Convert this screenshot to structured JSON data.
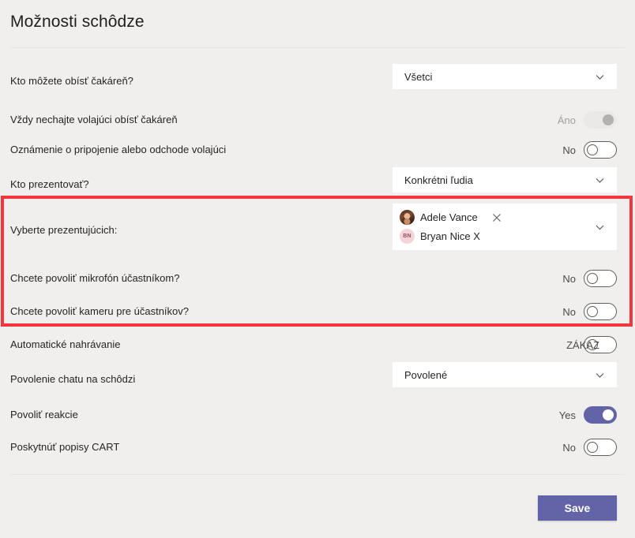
{
  "header": {
    "title": "Možnosti schôdze"
  },
  "rows": [
    {
      "label": "Kto môžete obísť čakáreň?",
      "control": "dropdown",
      "value": "Všetci"
    },
    {
      "label": "Vždy nechajte volajúci obísť čakáreň",
      "control": "toggle",
      "state_label": "Áno",
      "state": "disabled-on"
    },
    {
      "label": "Oznámenie o pripojenie alebo odchode volajúci",
      "control": "toggle",
      "state_label": "No",
      "state": "off"
    },
    {
      "label": "Kto prezentovať?",
      "control": "dropdown",
      "value": "Konkrétni ľudia"
    },
    {
      "label": "Vyberte prezentujúcich:",
      "control": "people-picker"
    },
    {
      "label": "Chcete povoliť mikrofón účastníkom?",
      "control": "toggle",
      "state_label": "No",
      "state": "off"
    },
    {
      "label": "Chcete povoliť kameru pre účastníkov?",
      "control": "toggle",
      "state_label": "No",
      "state": "off"
    },
    {
      "label": "Automatické nahrávanie",
      "control": "toggle",
      "state_label": "ZÁKAZ",
      "state": "off"
    },
    {
      "label": "Povolenie chatu na schôdzi",
      "control": "dropdown",
      "value": "Povolené"
    },
    {
      "label": "Povoliť reakcie",
      "control": "toggle",
      "state_label": "Yes",
      "state": "on"
    },
    {
      "label": "Poskytnúť popisy CART",
      "control": "toggle",
      "state_label": "No",
      "state": "off"
    }
  ],
  "presenters": [
    {
      "name": "Adele Vance",
      "avatar_type": "photo",
      "initials": ""
    },
    {
      "name": "Bryan Nice X",
      "avatar_type": "initials",
      "initials": "BN"
    }
  ],
  "footer": {
    "save_label": "Save"
  },
  "colors": {
    "accent": "#6264a7",
    "highlight": "#f4373d",
    "background": "#f0efee",
    "field_background": "#ffffff"
  }
}
